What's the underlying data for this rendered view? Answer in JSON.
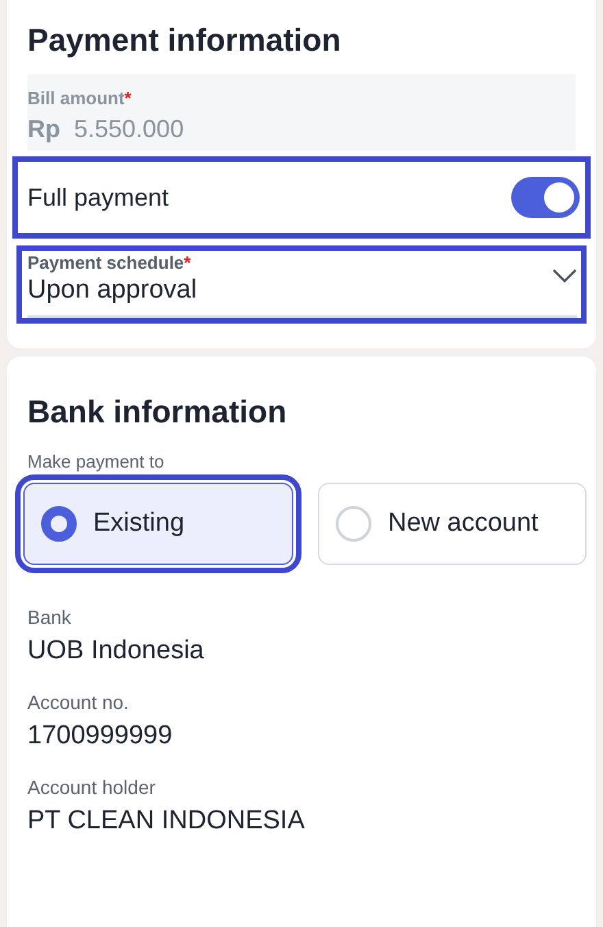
{
  "payment_information": {
    "title": "Payment information",
    "bill_amount": {
      "label": "Bill amount",
      "required_mark": "*",
      "currency": "Rp",
      "value": "5.550.000",
      "disabled": true
    },
    "full_payment": {
      "label": "Full payment",
      "on": true,
      "highlighted": true
    },
    "payment_schedule": {
      "label": "Payment schedule",
      "required_mark": "*",
      "value": "Upon approval",
      "highlighted": true
    }
  },
  "bank_information": {
    "title": "Bank information",
    "make_payment_to": {
      "label": "Make payment to",
      "options": [
        {
          "label": "Existing",
          "selected": true,
          "highlighted": true
        },
        {
          "label": "New account",
          "selected": false,
          "highlighted": false
        }
      ]
    },
    "fields": [
      {
        "label": "Bank",
        "value": "UOB Indonesia"
      },
      {
        "label": "Account no.",
        "value": "1700999999"
      },
      {
        "label": "Account holder",
        "value": "PT CLEAN INDONESIA"
      }
    ]
  }
}
